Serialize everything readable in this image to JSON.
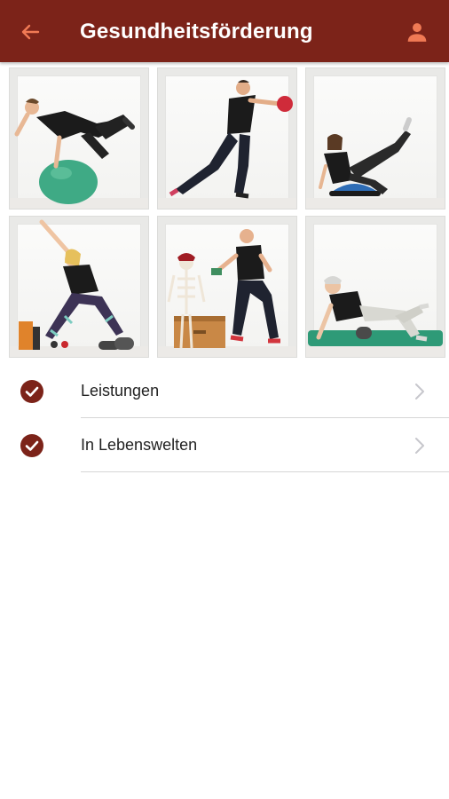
{
  "header": {
    "title": "Gesundheitsförderung",
    "back_icon": "arrow-left-icon",
    "profile_icon": "person-icon",
    "background_color": "#7c2319",
    "back_icon_color": "#f07a55"
  },
  "gallery": {
    "items": [
      {
        "icon": "exercise-photo-ball"
      },
      {
        "icon": "exercise-photo-medicine-ball"
      },
      {
        "icon": "exercise-photo-balance-board"
      },
      {
        "icon": "exercise-photo-stretch"
      },
      {
        "icon": "exercise-photo-skeleton"
      },
      {
        "icon": "exercise-photo-foam-roller"
      }
    ]
  },
  "menu": {
    "items": [
      {
        "label": "Leistungen",
        "icon": "check-circle-icon"
      },
      {
        "label": "In Lebenswelten",
        "icon": "check-circle-icon"
      }
    ],
    "accent_color": "#7c2319"
  }
}
